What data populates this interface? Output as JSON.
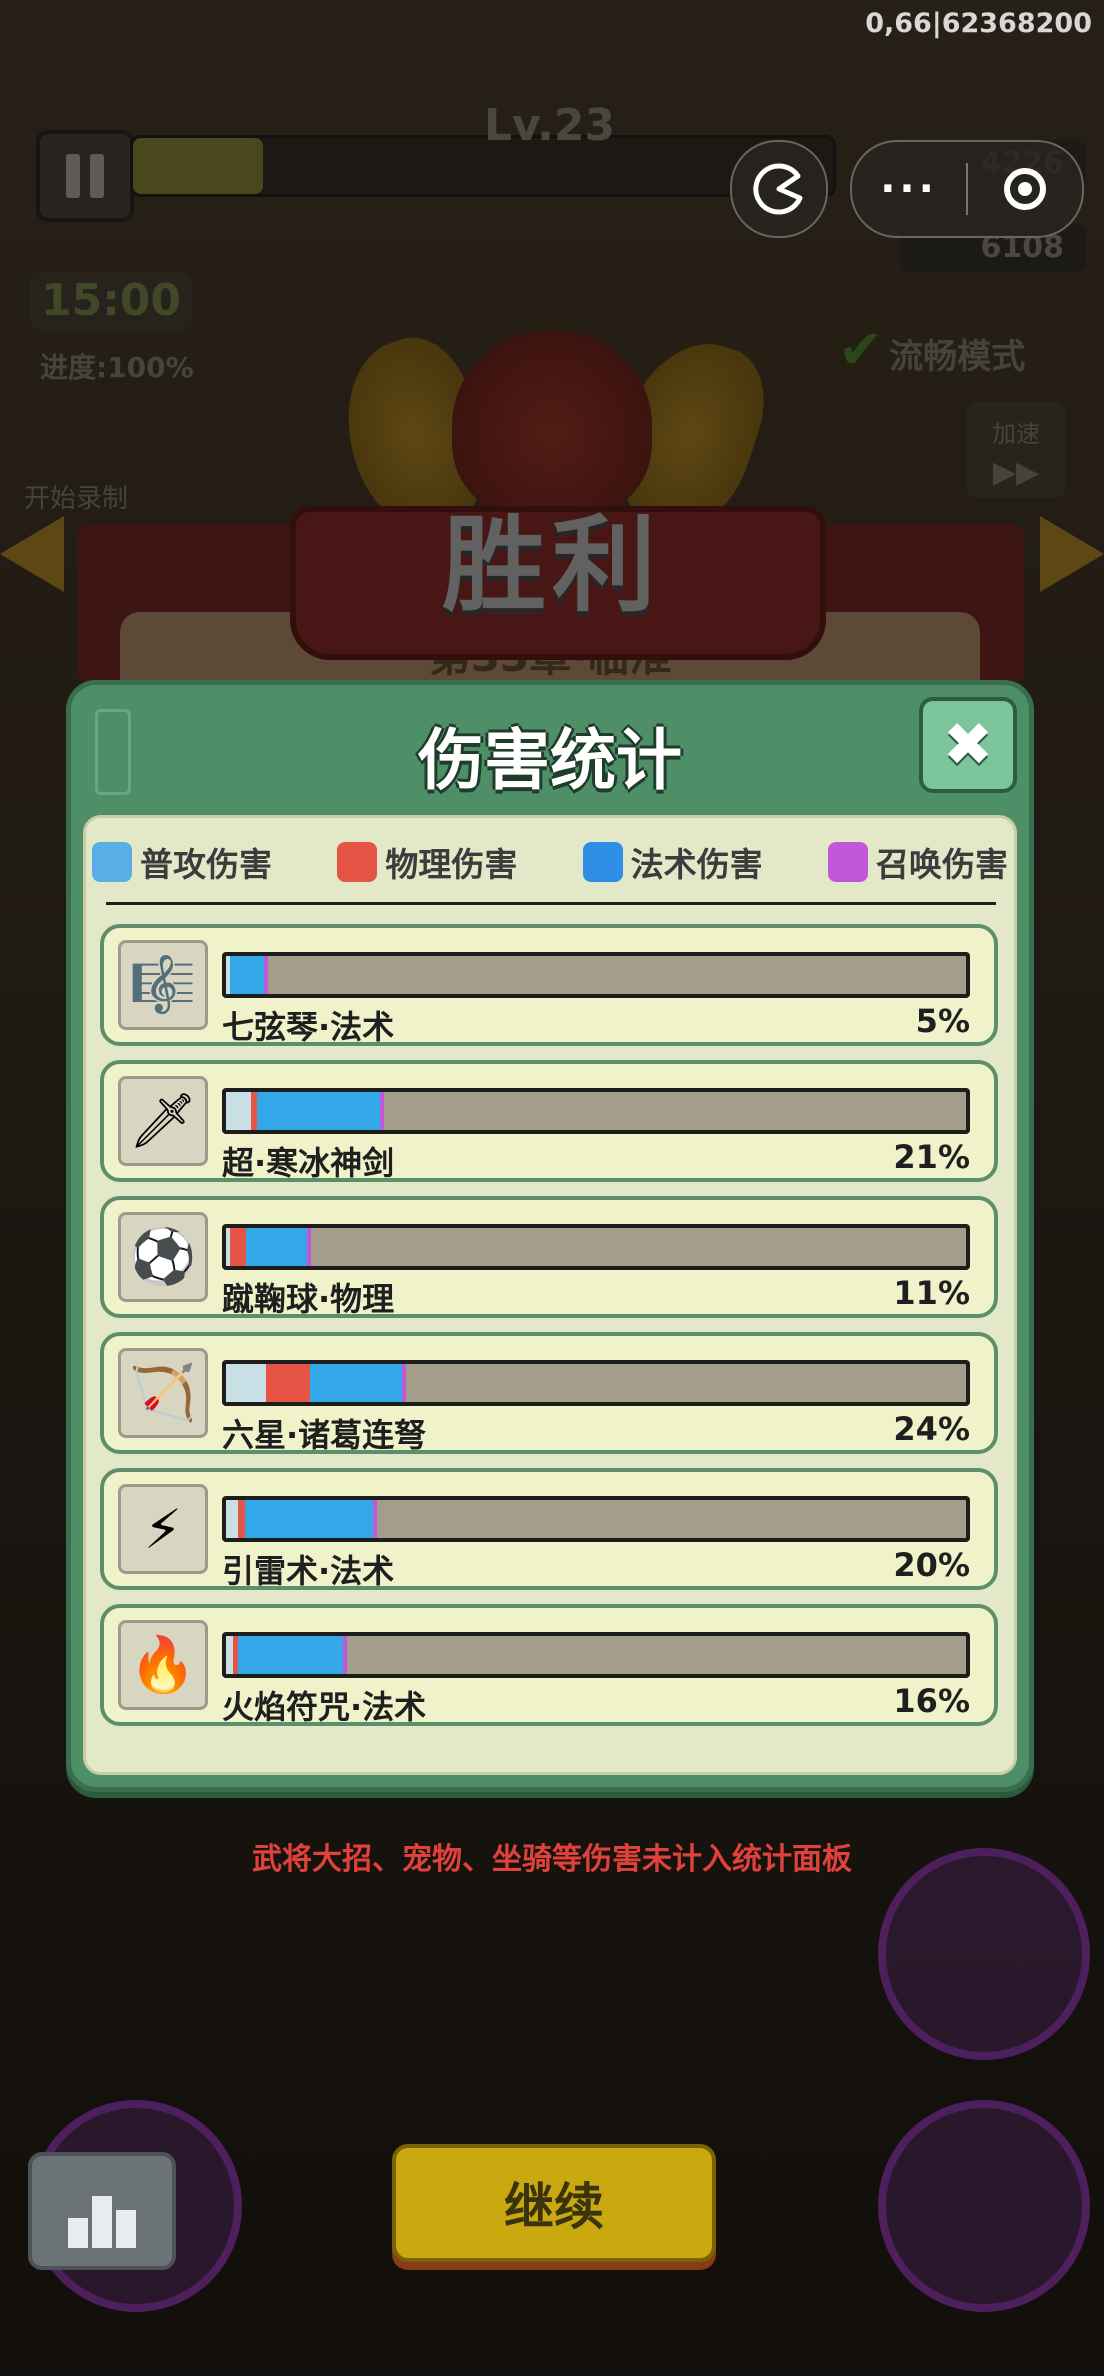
{
  "status_bar": {
    "build_id": "0,66|62368200"
  },
  "hud": {
    "level": "Lv.23",
    "timer": "15:00",
    "progress": "进度:100%",
    "record_label": "开始录制",
    "gem_count": "4226",
    "kill_count": "6108",
    "smooth_mode": "流畅模式",
    "speed_label": "加速",
    "speed_arrows": "▶▶"
  },
  "capsule": {
    "more": "···"
  },
  "victory": {
    "title": "胜利",
    "stage": "第33章·临淮"
  },
  "damage_panel": {
    "title": "伤害统计",
    "close": "✖",
    "legend": [
      {
        "label": "普攻伤害",
        "icon": "sword-icon",
        "color": "#5aaee8"
      },
      {
        "label": "物理伤害",
        "icon": "fist-icon",
        "color": "#e55444"
      },
      {
        "label": "法术伤害",
        "icon": "flame-icon",
        "color": "#2f8fe6"
      },
      {
        "label": "召唤伤害",
        "icon": "paw-icon",
        "color": "#c257d9"
      }
    ],
    "rows": [
      {
        "name": "七弦琴·法术",
        "pct_label": "5%",
        "icon": "guqin-icon",
        "glyph": "🎼",
        "segments": [
          {
            "type": "normal",
            "value": 0.2
          },
          {
            "type": "physical",
            "value": 0
          },
          {
            "type": "magic",
            "value": 4.6
          },
          {
            "type": "summon",
            "value": 0.2
          }
        ]
      },
      {
        "name": "超·寒冰神剑",
        "pct_label": "21%",
        "icon": "ice-sword-icon",
        "glyph": "🗡",
        "segments": [
          {
            "type": "normal",
            "value": 3.4
          },
          {
            "type": "physical",
            "value": 0.8
          },
          {
            "type": "magic",
            "value": 16.6
          },
          {
            "type": "summon",
            "value": 0.2
          }
        ]
      },
      {
        "name": "蹴鞠球·物理",
        "pct_label": "11%",
        "icon": "kickball-icon",
        "glyph": "⚽",
        "segments": [
          {
            "type": "normal",
            "value": 0.4
          },
          {
            "type": "physical",
            "value": 2.2
          },
          {
            "type": "magic",
            "value": 8.2
          },
          {
            "type": "summon",
            "value": 0.2
          }
        ]
      },
      {
        "name": "六星·诸葛连弩",
        "pct_label": "24%",
        "icon": "crossbow-icon",
        "glyph": "🏹",
        "segments": [
          {
            "type": "normal",
            "value": 5.4
          },
          {
            "type": "physical",
            "value": 6.0
          },
          {
            "type": "magic",
            "value": 12.4
          },
          {
            "type": "summon",
            "value": 0.2
          }
        ]
      },
      {
        "name": "引雷术·法术",
        "pct_label": "20%",
        "icon": "lightning-icon",
        "glyph": "⚡",
        "segments": [
          {
            "type": "normal",
            "value": 1.6
          },
          {
            "type": "physical",
            "value": 1.0
          },
          {
            "type": "magic",
            "value": 17.2
          },
          {
            "type": "summon",
            "value": 0.2
          }
        ]
      },
      {
        "name": "火焰符咒·法术",
        "pct_label": "16%",
        "icon": "fire-talisman-icon",
        "glyph": "🔥",
        "segments": [
          {
            "type": "normal",
            "value": 1.0
          },
          {
            "type": "physical",
            "value": 0.6
          },
          {
            "type": "magic",
            "value": 14.2
          },
          {
            "type": "summon",
            "value": 0.2
          }
        ]
      }
    ]
  },
  "footer_note": "武将大招、宠物、坐骑等伤害未计入统计面板",
  "continue_button": "继续",
  "colors": {
    "normal": "#c9dfe6",
    "physical": "#e55444",
    "magic": "#33a8e8",
    "summon": "#c257d9"
  }
}
